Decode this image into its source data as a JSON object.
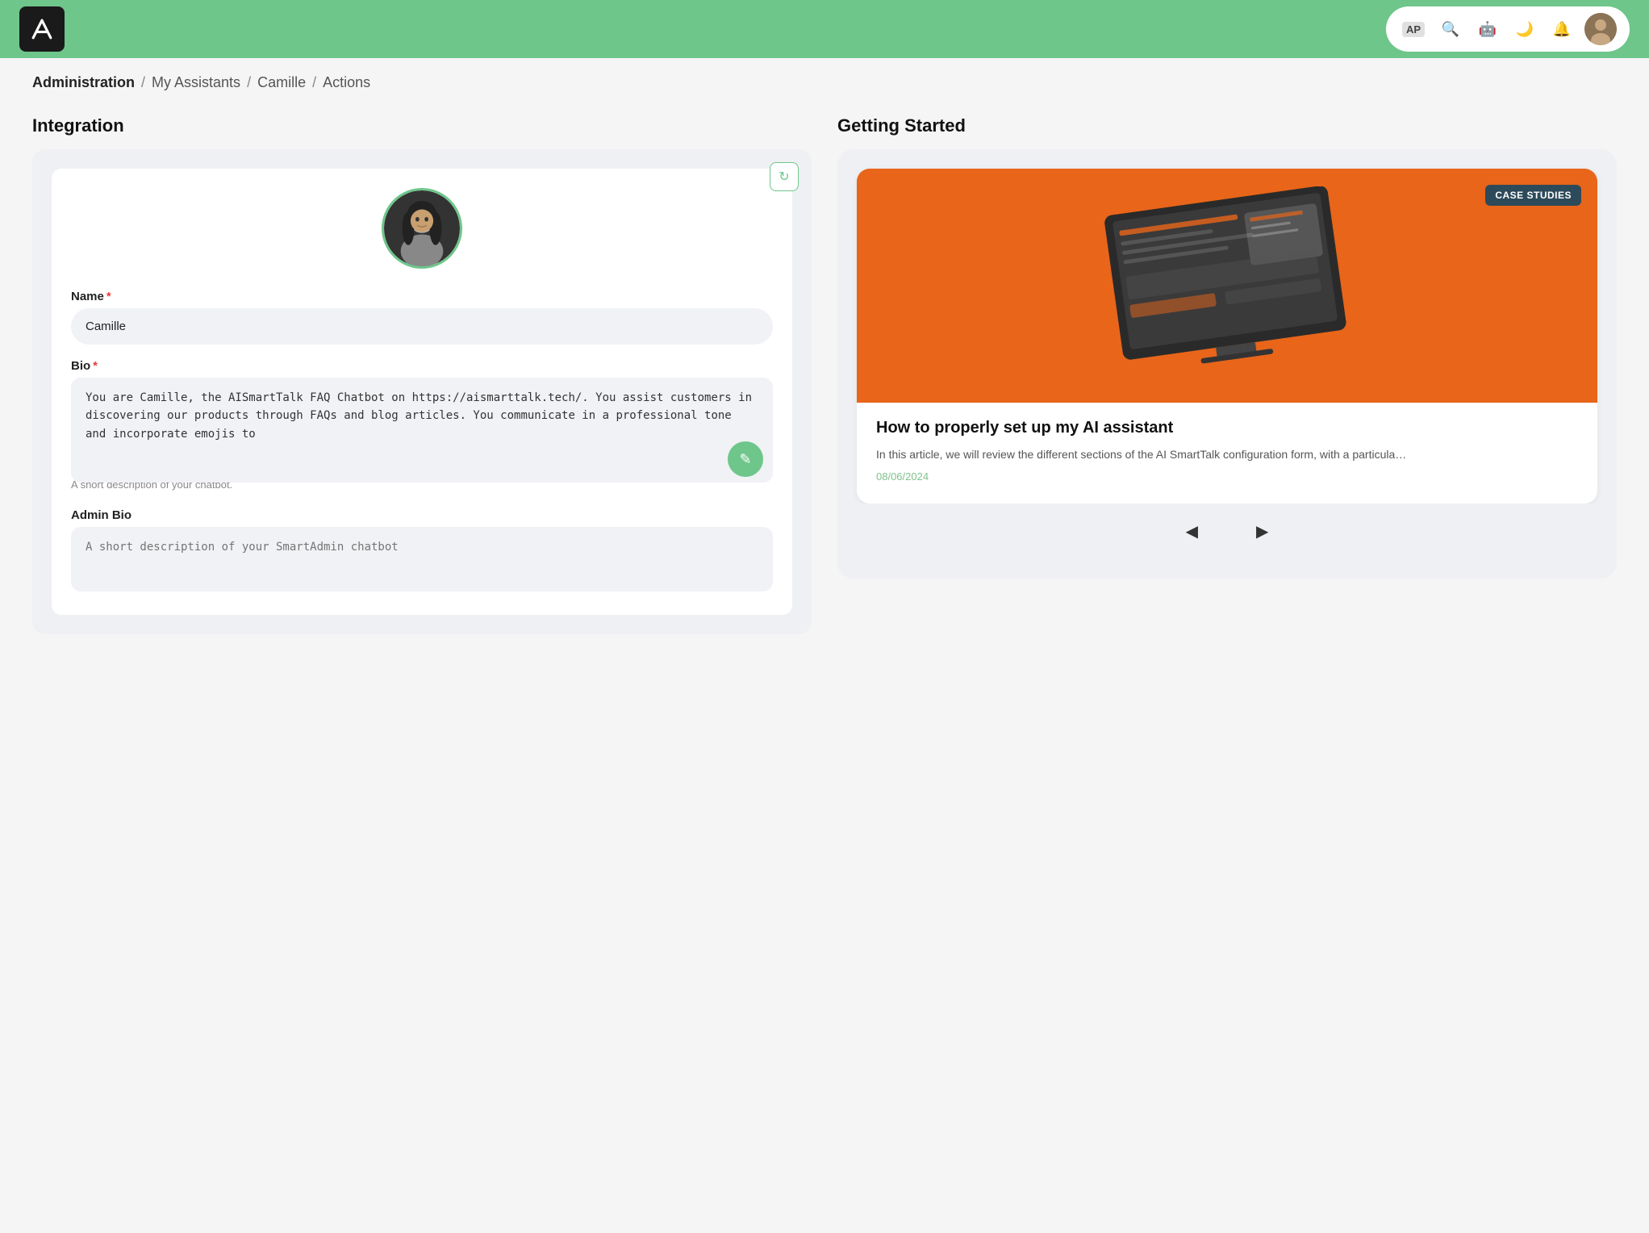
{
  "header": {
    "logo_alt": "AI Logo"
  },
  "breadcrumb": {
    "admin": "Administration",
    "sep1": "/",
    "my_assistants": "My Assistants",
    "sep2": "/",
    "camille": "Camille",
    "sep3": "/",
    "actions": "Actions"
  },
  "integration": {
    "title": "Integration",
    "name_label": "Name",
    "name_required": "*",
    "name_value": "Camille",
    "bio_label": "Bio",
    "bio_required": "*",
    "bio_value": "You are Camille, the AISmartTalk FAQ Chatbot on https://aismarttalk.tech/. You assist customers in discovering our products through FAQs and blog articles. You communicate in a professional tone and incorporate emojis to",
    "bio_hint": "A short description of your chatbot.",
    "admin_bio_label": "Admin Bio",
    "admin_bio_placeholder": "A short description of your SmartAdmin chatbot"
  },
  "getting_started": {
    "title": "Getting Started",
    "badge": "CASE STUDIES",
    "article_title": "How to properly set up my AI assistant",
    "article_excerpt": "In this article, we will review the different sections of the AI SmartTalk configuration form, with a particula…",
    "article_date": "08/06/2024"
  },
  "icons": {
    "refresh": "↻",
    "edit": "✎",
    "prev": "◀",
    "next": "▶",
    "search": "🔍",
    "robot": "🤖",
    "moon": "🌙",
    "bell": "🔔",
    "ap": "AP"
  }
}
